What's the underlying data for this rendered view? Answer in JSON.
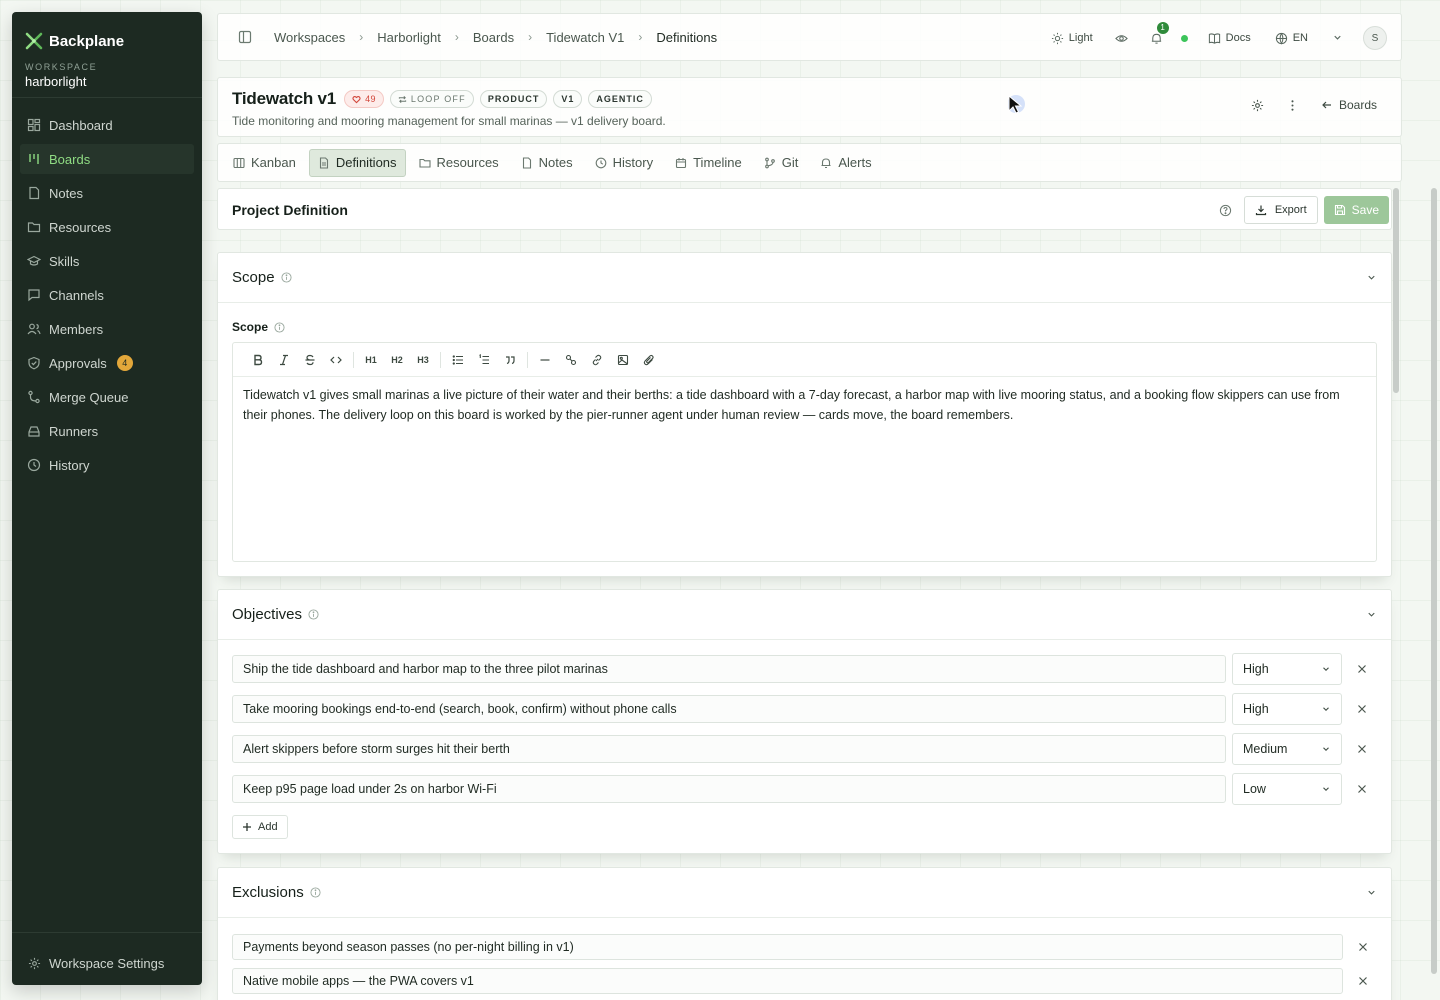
{
  "sidebar": {
    "brand": "Backplane",
    "workspace_label": "WORKSPACE",
    "workspace_name": "harborlight",
    "items": [
      {
        "label": "Dashboard"
      },
      {
        "label": "Boards"
      },
      {
        "label": "Notes"
      },
      {
        "label": "Resources"
      },
      {
        "label": "Skills"
      },
      {
        "label": "Channels"
      },
      {
        "label": "Members"
      },
      {
        "label": "Approvals",
        "badge": "4"
      },
      {
        "label": "Merge Queue"
      },
      {
        "label": "Runners"
      },
      {
        "label": "History"
      }
    ],
    "active_item": "Boards",
    "settings_label": "Workspace Settings"
  },
  "topbar": {
    "breadcrumbs": [
      "Workspaces",
      "Harborlight",
      "Boards",
      "Tidewatch V1",
      "Definitions"
    ],
    "theme_label": "Light",
    "notifications_count": "1",
    "docs_label": "Docs",
    "language": "EN",
    "avatar_initial": "S"
  },
  "board": {
    "title": "Tidewatch v1",
    "heart_count": "49",
    "loop_label": "LOOP OFF",
    "tags": [
      "PRODUCT",
      "V1",
      "AGENTIC"
    ],
    "description": "Tide monitoring and mooring management for small marinas — v1 delivery board.",
    "back_label": "Boards"
  },
  "tabs": [
    {
      "label": "Kanban",
      "icon": "kanban-icon"
    },
    {
      "label": "Definitions",
      "icon": "document-icon"
    },
    {
      "label": "Resources",
      "icon": "folder-icon"
    },
    {
      "label": "Notes",
      "icon": "note-icon"
    },
    {
      "label": "History",
      "icon": "clock-icon"
    },
    {
      "label": "Timeline",
      "icon": "calendar-icon"
    },
    {
      "label": "Git",
      "icon": "git-branch-icon"
    },
    {
      "label": "Alerts",
      "icon": "bell-icon"
    }
  ],
  "active_tab": "Definitions",
  "definition": {
    "title": "Project Definition",
    "export_label": "Export",
    "save_label": "Save"
  },
  "scope": {
    "section_title": "Scope",
    "field_label": "Scope",
    "text": "Tidewatch v1 gives small marinas a live picture of their water and their berths: a tide dashboard with a 7-day forecast, a harbor map with live mooring status, and a booking flow skippers can use from their phones. The delivery loop on this board is worked by the pier-runner agent under human review — cards move, the board remembers.",
    "toolbar": {
      "h1": "H1",
      "h2": "H2",
      "h3": "H3"
    }
  },
  "objectives": {
    "section_title": "Objectives",
    "items": [
      {
        "text": "Ship the tide dashboard and harbor map to the three pilot marinas",
        "priority": "High"
      },
      {
        "text": "Take mooring bookings end-to-end (search, book, confirm) without phone calls",
        "priority": "High"
      },
      {
        "text": "Alert skippers before storm surges hit their berth",
        "priority": "Medium"
      },
      {
        "text": "Keep p95 page load under 2s on harbor Wi-Fi",
        "priority": "Low"
      }
    ],
    "add_label": "Add"
  },
  "exclusions": {
    "section_title": "Exclusions",
    "items": [
      {
        "text": "Payments beyond season passes (no per-night billing in v1)"
      },
      {
        "text": "Native mobile apps — the PWA covers v1"
      }
    ]
  },
  "colors": {
    "sidebar_bg": "#1d2a22",
    "accent": "#8fdb83",
    "save_button": "#9dc79a",
    "badge": "#e3a73a"
  }
}
